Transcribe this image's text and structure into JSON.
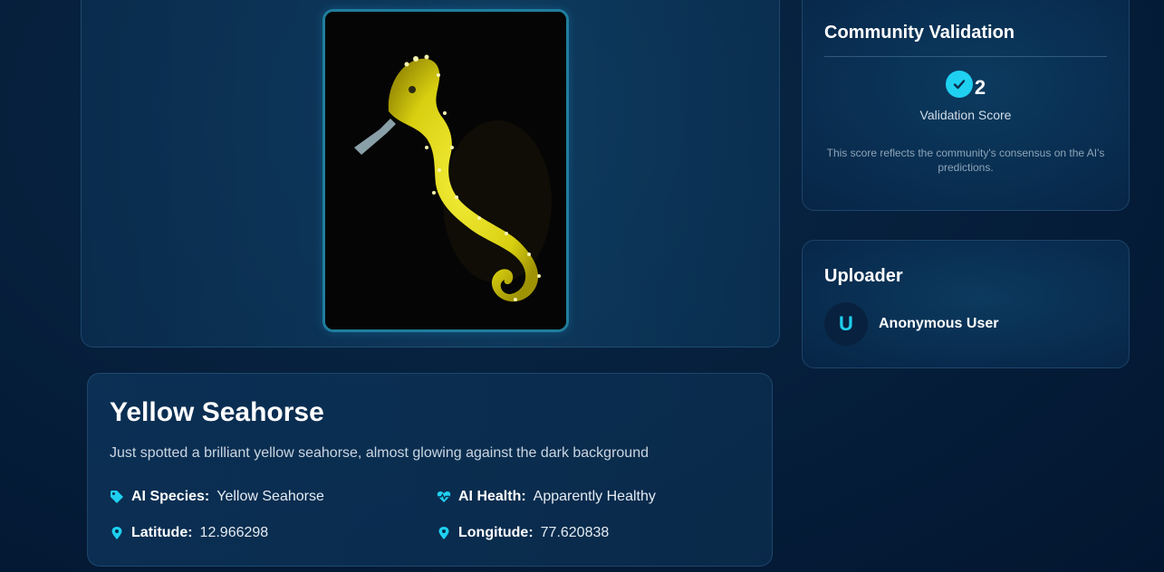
{
  "observation": {
    "title": "Yellow Seahorse",
    "description": "Just spotted a brilliant yellow seahorse, almost glowing against the dark background",
    "image_alt": "Yellow seahorse photo",
    "fields": {
      "ai_species": {
        "label": "AI Species:",
        "value": "Yellow Seahorse",
        "icon": "tag-icon"
      },
      "ai_health": {
        "label": "AI Health:",
        "value": "Apparently Healthy",
        "icon": "heart-pulse-icon"
      },
      "latitude": {
        "label": "Latitude:",
        "value": "12.966298",
        "icon": "map-pin-icon"
      },
      "longitude": {
        "label": "Longitude:",
        "value": "77.620838",
        "icon": "map-pin-icon"
      }
    }
  },
  "validation": {
    "heading": "Community Validation",
    "score": "2",
    "score_label": "Validation Score",
    "note": "This score reflects the community's consensus on the AI's predictions.",
    "icon": "check-circle-icon"
  },
  "uploader": {
    "heading": "Uploader",
    "avatar_initial": "U",
    "name": "Anonymous User"
  },
  "colors": {
    "accent": "#1fd0f0",
    "background": "#041a35",
    "frame_border": "#1f7e9e"
  }
}
